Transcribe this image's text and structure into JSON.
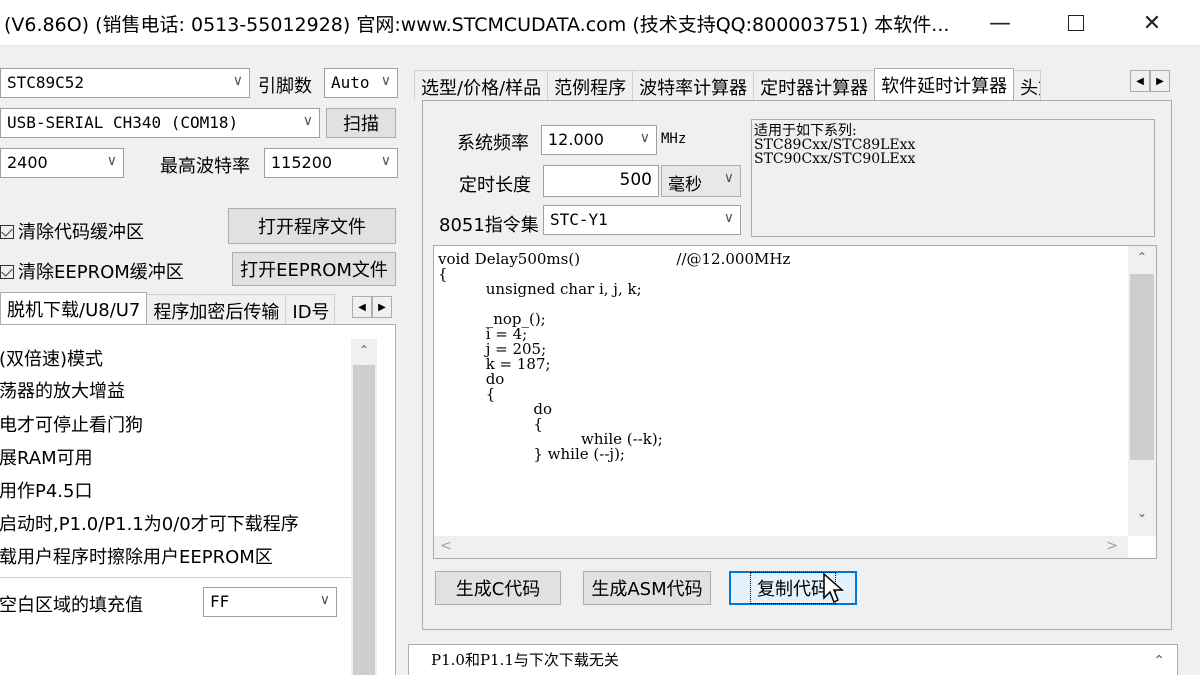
{
  "window": {
    "title": "(V6.86O) (销售电话: 0513-55012928) 官网:www.STCMCUDATA.com  (技术支持QQ:800003751) 本软件...",
    "min": "—",
    "close": "✕"
  },
  "left": {
    "mcu_select": "STC89C52",
    "pin_label": "引脚数",
    "pin_value": "Auto",
    "port_select": "USB-SERIAL CH340 (COM18)",
    "scan_button": "扫描",
    "baud_min": "2400",
    "max_baud_label": "最高波特率",
    "max_baud_value": "115200",
    "clear_code_label": "清除代码缓冲区",
    "open_program_button": "打开程序文件",
    "clear_eeprom_label": "清除EEPROM缓冲区",
    "open_eeprom_button": "打开EEPROM文件",
    "tabs": [
      "脱机下载/U8/U7",
      "程序加密后传输",
      "ID号"
    ],
    "options": [
      "(双倍速)模式",
      "荡器的放大增益",
      "电才可停止看门狗",
      "展RAM可用",
      "用作P4.5口",
      "启动时,P1.0/P1.1为0/0才可下载程序",
      "载用户程序时擦除用户EEPROM区"
    ],
    "fill_label": "空白区域的填充值",
    "fill_value": "FF"
  },
  "right": {
    "tabs": [
      "选型/价格/样品",
      "范例程序",
      "波特率计算器",
      "定时器计算器",
      "软件延时计算器",
      "头文"
    ],
    "active_tab_index": 4,
    "freq_label": "系统频率",
    "freq_value": "12.000",
    "freq_unit": "MHz",
    "length_label": "定时长度",
    "length_value": "500",
    "length_unit": "毫秒",
    "isa_label": "8051指令集",
    "isa_value": "STC-Y1",
    "series_info": "适用于如下系列:\nSTC89Cxx/STC89LExx\nSTC90Cxx/STC90LExx",
    "code": "void Delay500ms()\t\t//@12.000MHz\n{\n\tunsigned char i, j, k;\n\n\t_nop_();\n\ti = 4;\n\tj = 205;\n\tk = 187;\n\tdo\n\t{\n\t\tdo\n\t\t{\n\t\t\twhile (--k);\n\t\t} while (--j);",
    "gen_c_button": "生成C代码",
    "gen_asm_button": "生成ASM代码",
    "copy_button": "复制代码",
    "bottom_info": "P1.0和P1.1与下次下载无关"
  }
}
